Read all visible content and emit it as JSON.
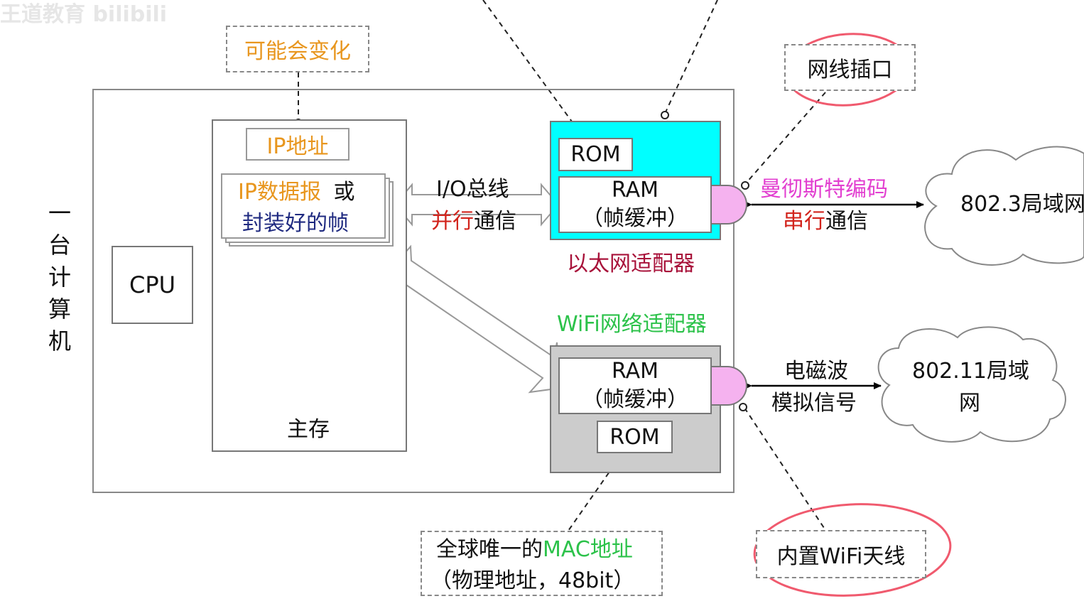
{
  "watermark": "王道教育 bilibili",
  "computer_label": "一台计算机",
  "cpu_label": "CPU",
  "main_memory": {
    "label": "主存",
    "ip_address": "IP地址",
    "datagram_line1": "IP数据报",
    "datagram_or": "或",
    "datagram_line2": "封装好的帧"
  },
  "may_change": "可能会变化",
  "io_bus": {
    "label": "I/O总线",
    "parallel": "并行",
    "comm": "通信"
  },
  "ethernet_adapter": {
    "rom": "ROM",
    "ram_line1": "RAM",
    "ram_line2": "（帧缓冲）",
    "name": "以太网适配器"
  },
  "wifi_adapter": {
    "name": "WiFi网络适配器",
    "ram_line1": "RAM",
    "ram_line2": "（帧缓冲）",
    "rom": "ROM"
  },
  "port_label": "网线插口",
  "manchester": "曼彻斯特编码",
  "serial": "串行",
  "serial_comm": "通信",
  "lan_8023": "802.3局域网",
  "radio_line1": "电磁波",
  "radio_line2": "模拟信号",
  "lan_80211_line1": "802.11局域",
  "lan_80211_line2": "网",
  "mac_line1_prefix": "全球唯一的",
  "mac_line1_highlight": "MAC地址",
  "mac_line2": "（物理地址，48bit）",
  "antenna_label": "内置WiFi天线",
  "colors": {
    "ethernet_fill": "#00ffff",
    "wifi_fill": "#cccccc",
    "connector": "#f5b2ef",
    "highlight_circle": "#f05a6e"
  }
}
